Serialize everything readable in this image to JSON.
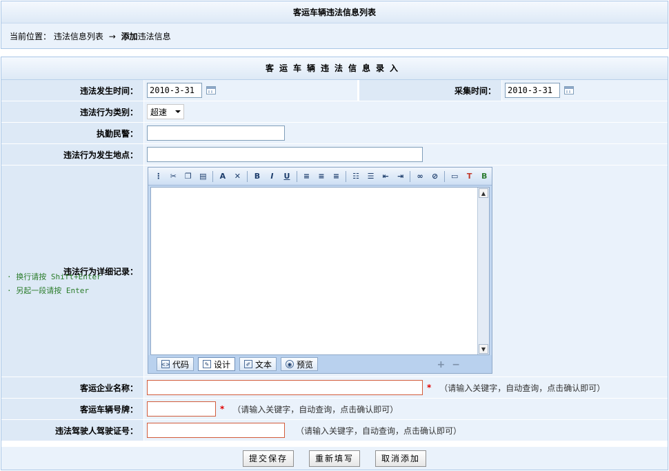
{
  "header": {
    "title": "客运车辆违法信息列表",
    "crumb_label": "当前位置：",
    "crumb_link": "违法信息列表",
    "crumb_arrow": "→",
    "crumb_current_strong": "添加",
    "crumb_current_rest": "违法信息"
  },
  "form": {
    "title": "客运车辆违法信息录入",
    "fields": {
      "occur_time": {
        "label": "违法发生时间：",
        "value": "2010-3-31"
      },
      "collect_time": {
        "label": "采集时间：",
        "value": "2010-3-31"
      },
      "category": {
        "label": "违法行为类别：",
        "value": "超速"
      },
      "officer": {
        "label": "执勤民警：",
        "value": ""
      },
      "location": {
        "label": "违法行为发生地点：",
        "value": ""
      },
      "detail": {
        "label": "违法行为详细记录："
      },
      "company": {
        "label": "客运企业名称：",
        "value": "",
        "hint": "（请输入关键字，自动查询，点击确认即可）"
      },
      "plate": {
        "label": "客运车辆号牌：",
        "value": "",
        "hint": "（请输入关键字，自动查询，点击确认即可）"
      },
      "license": {
        "label": "违法驾驶人驾驶证号：",
        "value": "",
        "hint": "（请输入关键字，自动查询，点击确认即可）"
      }
    },
    "required_mark": "*",
    "tips": [
      "· 换行请按 Shift+Enter",
      "· 另起一段请按 Enter"
    ]
  },
  "editor": {
    "tabs": [
      {
        "label": "代码",
        "icon": "code-icon"
      },
      {
        "label": "设计",
        "icon": "design-icon"
      },
      {
        "label": "文本",
        "icon": "text-icon"
      },
      {
        "label": "预览",
        "icon": "preview-icon"
      }
    ],
    "zoom_in": "+",
    "zoom_out": "−"
  },
  "buttons": {
    "submit": "提交保存",
    "reset": "重新填写",
    "cancel": "取消添加"
  }
}
